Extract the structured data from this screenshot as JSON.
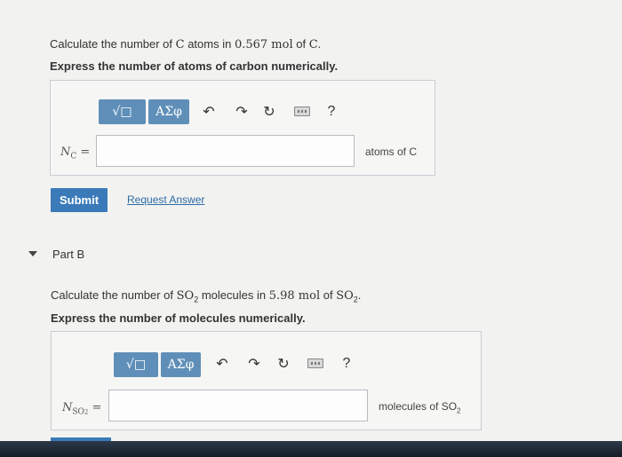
{
  "part_a": {
    "prompt_prefix": "Calculate the number of ",
    "prompt_element": "C",
    "prompt_mid": " atoms in ",
    "prompt_amount": "0.567 mol",
    "prompt_of": " of ",
    "prompt_element2": "C",
    "prompt_end": ".",
    "instruction": "Express the number of atoms of carbon numerically.",
    "var_main": "N",
    "var_sub": "C",
    "equals": " =",
    "input_value": "",
    "unit": "atoms of C",
    "submit": "Submit",
    "request": "Request Answer"
  },
  "toolbar": {
    "template_label": "√□",
    "greek_label": "ΑΣφ",
    "undo_icon": "undo-icon",
    "redo_icon": "redo-icon",
    "reset_icon": "reset-icon",
    "keyboard_icon": "keyboard-icon",
    "help": "?"
  },
  "part_b": {
    "title": "Part B",
    "prompt_prefix": "Calculate the number of ",
    "prompt_species": "SO",
    "prompt_species_sub": "2",
    "prompt_mid": " molecules in ",
    "prompt_amount": "5.98 mol",
    "prompt_of": " of ",
    "prompt_species2": "SO",
    "prompt_species2_sub": "2",
    "prompt_end": ".",
    "instruction": "Express the number of molecules numerically.",
    "var_main": "N",
    "var_sub": "SO",
    "var_sub2": "2",
    "equals": " =",
    "input_value": "",
    "unit_prefix": "molecules of SO",
    "unit_sub": "2"
  },
  "colors": {
    "accent": "#3a7ab9",
    "toolbar_button": "#5f8fb8"
  }
}
